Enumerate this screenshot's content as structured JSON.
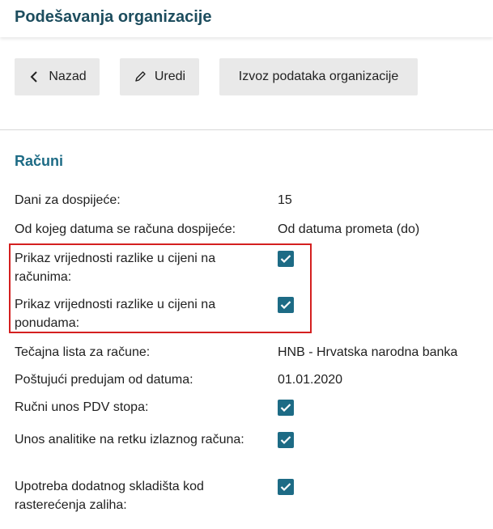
{
  "header": {
    "title": "Podešavanja organizacije"
  },
  "toolbar": {
    "back_label": "Nazad",
    "edit_label": "Uredi",
    "export_label": "Izvoz podataka organizacije"
  },
  "section": {
    "title": "Računi",
    "rows": [
      {
        "label": "Dani za dospijeće:",
        "value": "15"
      },
      {
        "label": "Od kojeg datuma se računa dospijeće:",
        "value": "Od datuma prometa (do)"
      },
      {
        "label": "Prikaz vrijednosti razlike u cijeni na računima:",
        "checked": true
      },
      {
        "label": "Prikaz vrijednosti razlike u cijeni na ponudama:",
        "checked": true
      },
      {
        "label": "Tečajna lista za račune:",
        "value": "HNB - Hrvatska narodna banka"
      },
      {
        "label": "Poštujući predujam od datuma:",
        "value": "01.01.2020"
      },
      {
        "label": "Ručni unos PDV stopa:",
        "checked": true
      },
      {
        "label": "Unos analitike na retku izlaznog računa:",
        "checked": true
      },
      {
        "label": "Upotreba dodatnog skladišta kod rasterećenja zaliha:",
        "checked": true
      }
    ]
  },
  "colors": {
    "accent": "#1d6b85",
    "title": "#1d4d5e",
    "highlight": "#d42020",
    "button_bg": "#e9e9e9"
  },
  "icons": {
    "back": "chevron-left-icon",
    "edit": "pencil-icon",
    "checkbox": "check-icon"
  }
}
